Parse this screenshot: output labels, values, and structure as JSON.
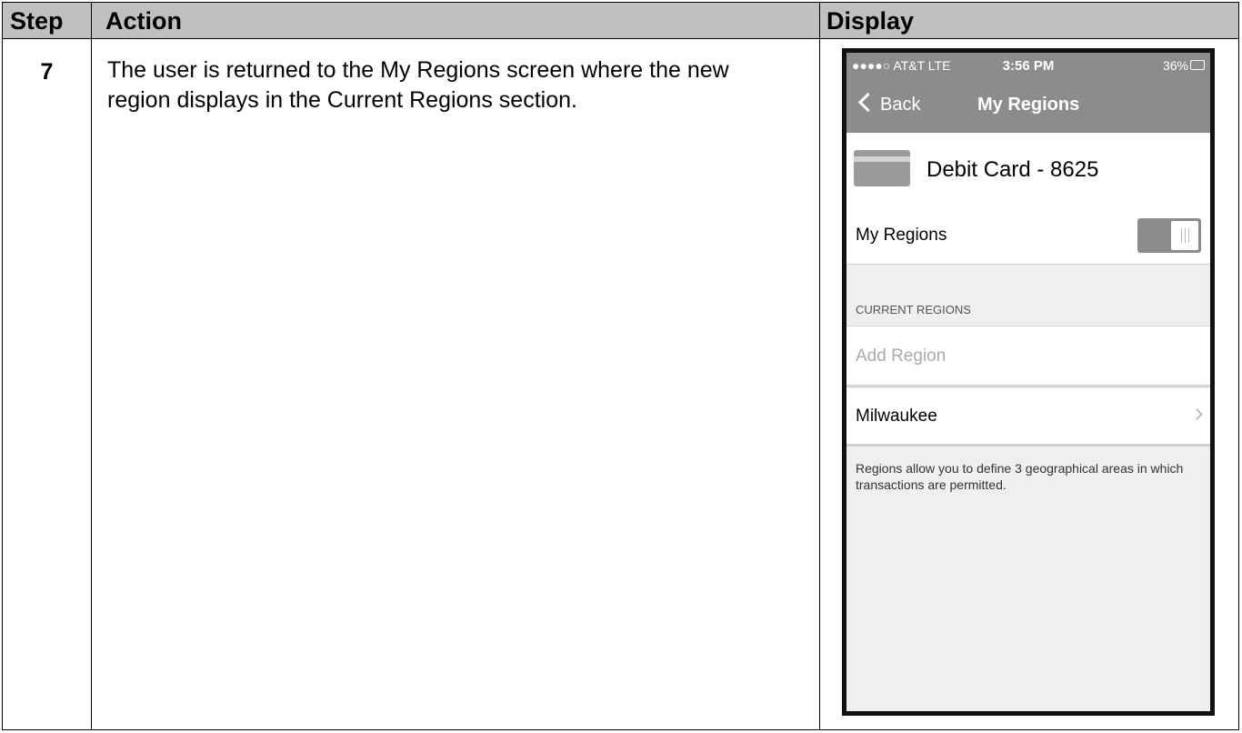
{
  "table": {
    "headers": {
      "step": "Step",
      "action": "Action",
      "display": "Display"
    },
    "row": {
      "step": "7",
      "action": "The user is returned to the My Regions screen where the new region displays in the Current Regions section."
    }
  },
  "phone": {
    "status_bar": {
      "carrier": "●●●●○ AT&T  LTE",
      "time": "3:56 PM",
      "battery": "36%"
    },
    "nav": {
      "back_label": "Back",
      "title": "My Regions"
    },
    "card": {
      "title": "Debit Card - 8625"
    },
    "toggle": {
      "label": "My Regions",
      "on": true
    },
    "section_header": "CURRENT REGIONS",
    "add_region_placeholder": "Add Region",
    "regions": [
      "Milwaukee"
    ],
    "footnote": "Regions allow you to define 3 geographical areas in which transactions are permitted."
  }
}
